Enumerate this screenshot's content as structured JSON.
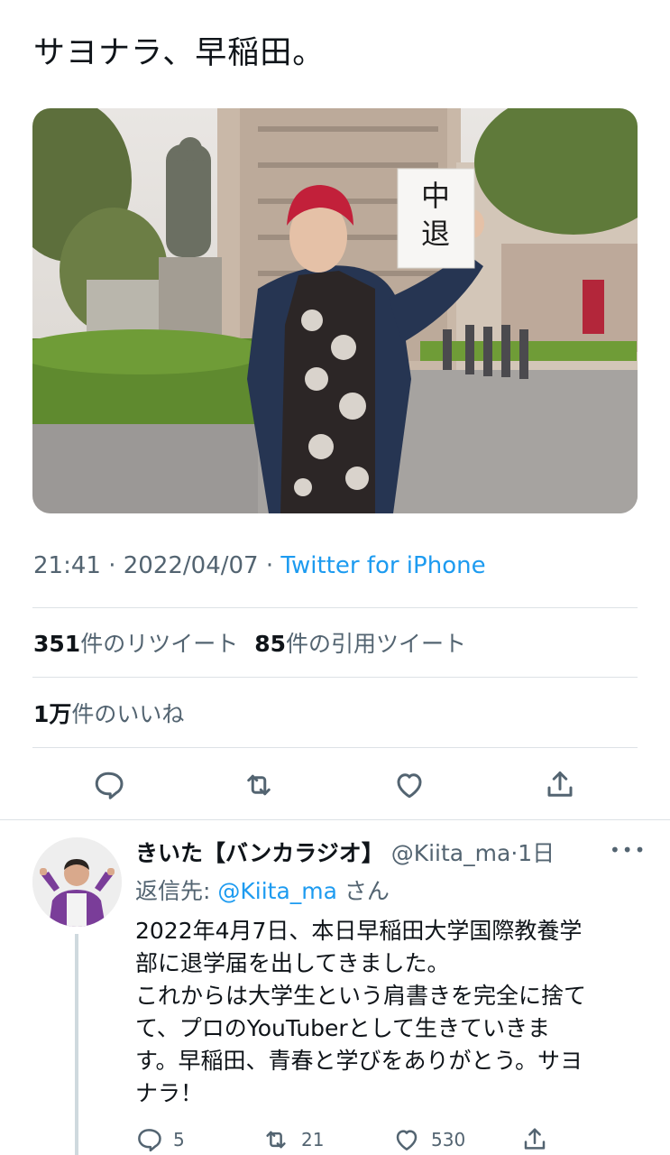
{
  "tweet": {
    "text": "サヨナラ、早稲田。",
    "photo": {
      "sign_text": "中\n退",
      "sign_line1": "中",
      "sign_line2": "退"
    },
    "time": "21:41",
    "separator": "·",
    "date": "2022/04/07",
    "source": "Twitter for iPhone",
    "retweets_count": "351",
    "retweets_label": "件のリツイート",
    "quotes_count": "85",
    "quotes_label": "件の引用ツイート",
    "likes_count": "1万",
    "likes_label": "件のいいね"
  },
  "actions": {
    "icons": [
      "reply-icon",
      "retweet-icon",
      "like-icon",
      "share-icon"
    ]
  },
  "reply": {
    "name": "きいた【バンカラジオ】",
    "handle": "@Kiita_ma",
    "separator": "·",
    "age": "1日",
    "more": "•••",
    "replying_to_label": "返信先: ",
    "replying_to_handle": "@Kiita_ma",
    "replying_to_suffix": "さん",
    "body_lines": [
      "2022年4月7日、本日早稲田大学国際教養学",
      "部に退学届を出してきました。",
      "これからは大学生という肩書きを完全に捨て",
      "て、プロのYouTuberとして生きていきま",
      "す。早稲田、青春と学びをありがとう。サヨ",
      "ナラ！"
    ],
    "reply_count": "5",
    "retweet_count": "21",
    "like_count": "530"
  },
  "colors": {
    "accent": "#1d9bf0",
    "secondary_text": "#536471",
    "primary_text": "#0f1419",
    "divider": "#dde2e6"
  }
}
